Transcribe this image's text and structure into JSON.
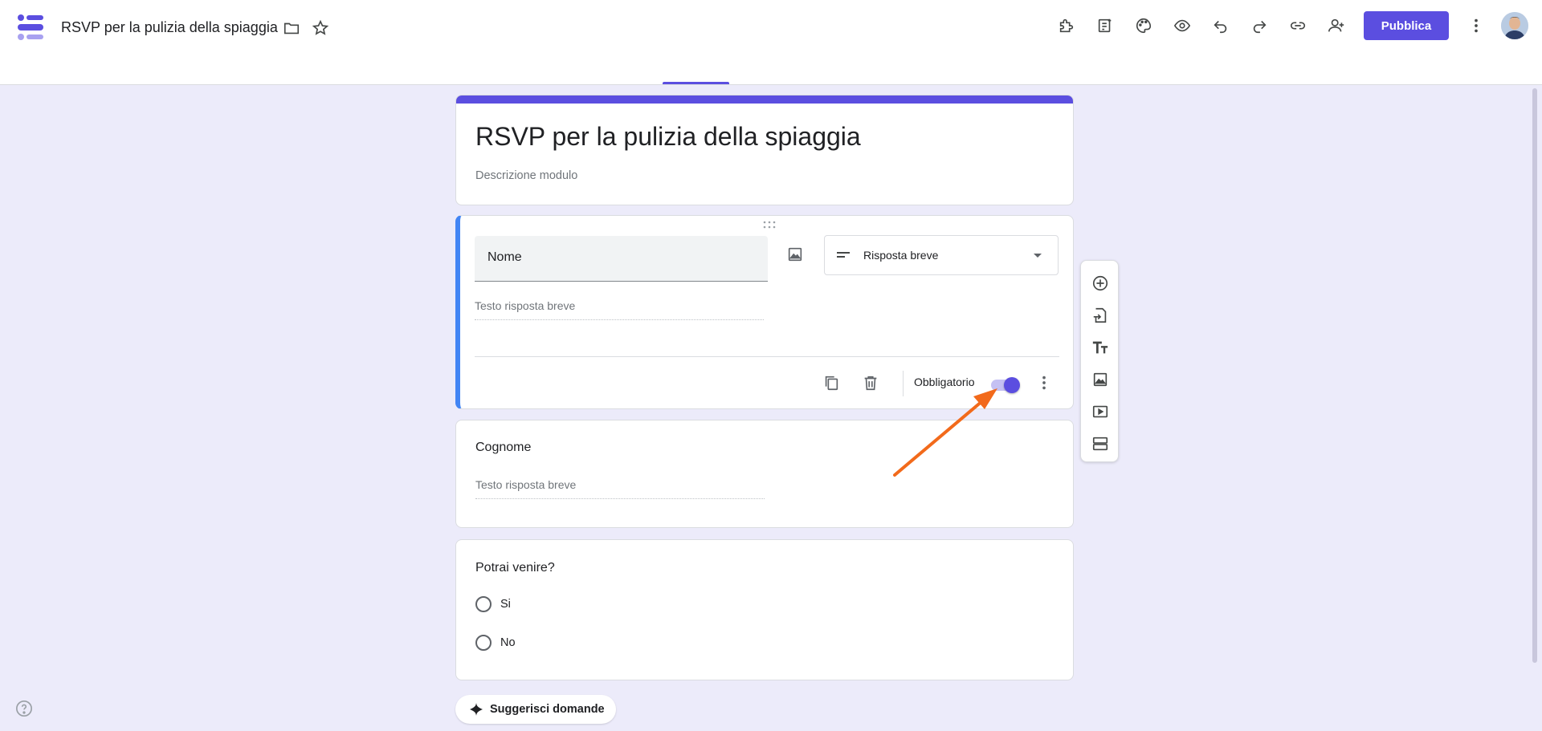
{
  "header": {
    "title": "RSVP per la pulizia della spiaggia",
    "publish_label": "Pubblica",
    "icons": [
      "folder-icon",
      "star-icon",
      "addon-icon",
      "form-template-icon",
      "palette-icon",
      "preview-eye-icon",
      "undo-icon",
      "redo-icon",
      "link-icon",
      "add-collaborator-icon",
      "more-vert-icon"
    ]
  },
  "form": {
    "title": "RSVP per la pulizia della spiaggia",
    "description_placeholder": "Descrizione modulo"
  },
  "question1": {
    "title": "Nome",
    "type_label": "Risposta breve",
    "answer_placeholder": "Testo risposta breve",
    "required_label": "Obbligatorio",
    "required_on": true
  },
  "question2": {
    "title": "Cognome",
    "answer_placeholder": "Testo risposta breve"
  },
  "question3": {
    "title": "Potrai venire?",
    "options": [
      "Si",
      "No"
    ]
  },
  "toolbar": {
    "items": [
      "add-question-icon",
      "import-questions-icon",
      "add-title-icon",
      "add-image-icon",
      "add-video-icon",
      "add-section-icon"
    ]
  },
  "suggest": {
    "label": "Suggerisci domande"
  },
  "colors": {
    "accent": "#5b4ee0",
    "focus_border": "#4285f4",
    "background": "#ecebfa",
    "annotation_arrow": "#f26a1b"
  }
}
